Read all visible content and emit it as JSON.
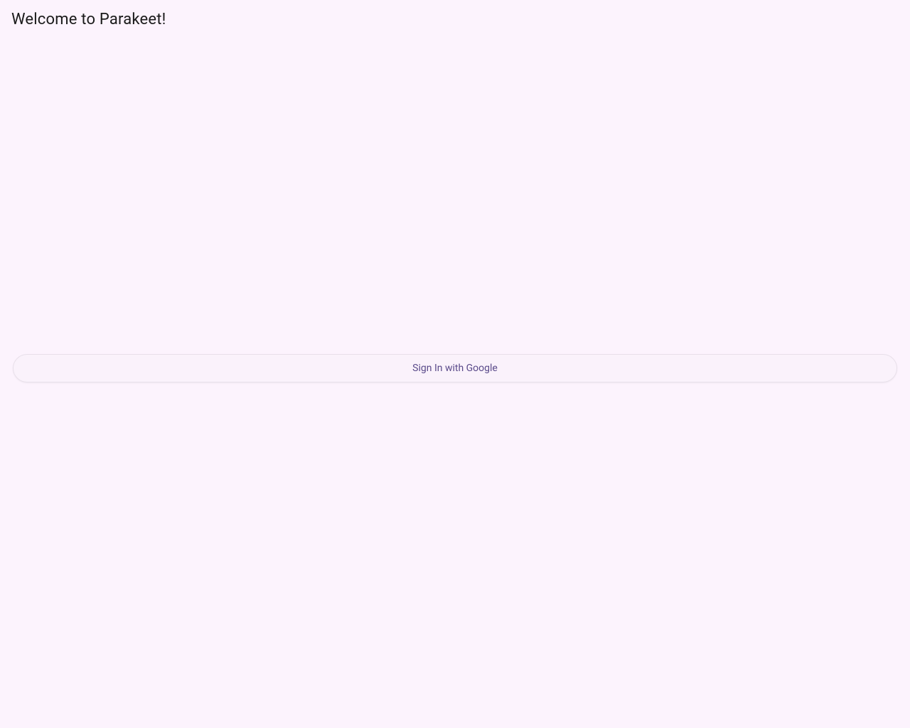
{
  "header": {
    "title": "Welcome to Parakeet!"
  },
  "auth": {
    "sign_in_button_label": "Sign In with Google"
  }
}
